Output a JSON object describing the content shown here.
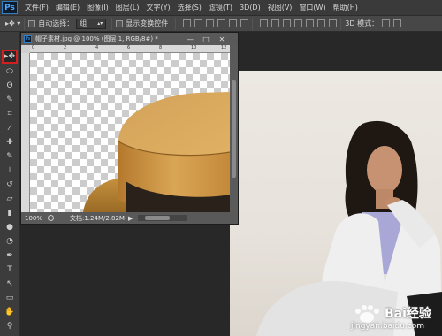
{
  "app": {
    "logo": "Ps",
    "menu": [
      "文件(F)",
      "编辑(E)",
      "图像(I)",
      "图层(L)",
      "文字(Y)",
      "选择(S)",
      "滤镜(T)",
      "3D(D)",
      "视图(V)",
      "窗口(W)",
      "帮助(H)"
    ]
  },
  "options_bar": {
    "auto_select_label": "自动选择：",
    "auto_select_value": "组",
    "show_transform_label": "显示变换控件",
    "mode_3d_label": "3D 模式："
  },
  "tools": [
    {
      "icon": "move-tool-icon",
      "glyph": "▸✥"
    },
    {
      "icon": "marquee-tool-icon",
      "glyph": "⬭"
    },
    {
      "icon": "lasso-tool-icon",
      "glyph": "ʘ"
    },
    {
      "icon": "quick-select-tool-icon",
      "glyph": "✎"
    },
    {
      "icon": "crop-tool-icon",
      "glyph": "⌗"
    },
    {
      "icon": "eyedropper-tool-icon",
      "glyph": "⁄"
    },
    {
      "icon": "healing-brush-tool-icon",
      "glyph": "✚"
    },
    {
      "icon": "brush-tool-icon",
      "glyph": "✎"
    },
    {
      "icon": "clone-stamp-tool-icon",
      "glyph": "⊥"
    },
    {
      "icon": "history-brush-tool-icon",
      "glyph": "↺"
    },
    {
      "icon": "eraser-tool-icon",
      "glyph": "▱"
    },
    {
      "icon": "gradient-tool-icon",
      "glyph": "▮"
    },
    {
      "icon": "blur-tool-icon",
      "glyph": "●"
    },
    {
      "icon": "dodge-tool-icon",
      "glyph": "◔"
    },
    {
      "icon": "pen-tool-icon",
      "glyph": "✒"
    },
    {
      "icon": "type-tool-icon",
      "glyph": "T"
    },
    {
      "icon": "path-select-tool-icon",
      "glyph": "↖"
    },
    {
      "icon": "shape-tool-icon",
      "glyph": "▭"
    },
    {
      "icon": "hand-tool-icon",
      "glyph": "✋"
    },
    {
      "icon": "zoom-tool-icon",
      "glyph": "⚲"
    }
  ],
  "document": {
    "title": "帽子素材.jpg @ 100% (图层 1, RGB/8#) *",
    "zoom": "100%",
    "info": "文档:1.24M/2.82M",
    "ruler_ticks": [
      "0",
      "2",
      "4",
      "6",
      "8",
      "10",
      "12"
    ],
    "ps_icon": "Ps",
    "minimize": "—",
    "maximize": "□",
    "close": "✕",
    "arrow": "▶"
  },
  "watermark": {
    "brand": "Bai经验",
    "url": "jingyan.baidu.com"
  },
  "colors": {
    "accent_red": "#d21f1f",
    "ps_blue": "#2f7fc5"
  }
}
